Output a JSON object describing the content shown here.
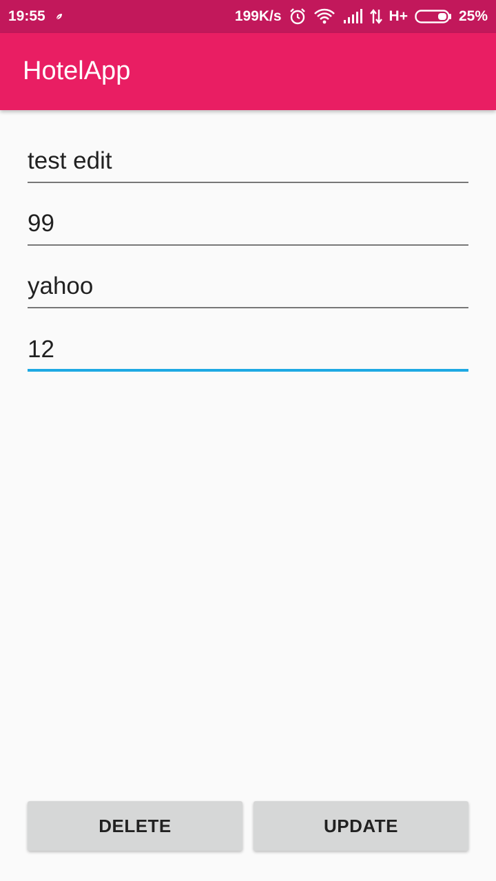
{
  "status_bar": {
    "time": "19:55",
    "network_speed": "199K/s",
    "network_type": "H+",
    "battery": "25%",
    "icons": [
      "notification-leaf-icon",
      "alarm-icon",
      "wifi-icon",
      "signal-icon",
      "data-arrows-icon",
      "battery-icon"
    ]
  },
  "app_bar": {
    "title": "HotelApp",
    "color": "#e91e63",
    "status_color": "#c2185b"
  },
  "form": {
    "fields": [
      {
        "value": "test edit"
      },
      {
        "value": "99"
      },
      {
        "value": "yahoo"
      },
      {
        "value": "12",
        "focused": true
      }
    ],
    "accent_color": "#1ea9e3"
  },
  "buttons": {
    "delete_label": "DELETE",
    "update_label": "UPDATE"
  }
}
